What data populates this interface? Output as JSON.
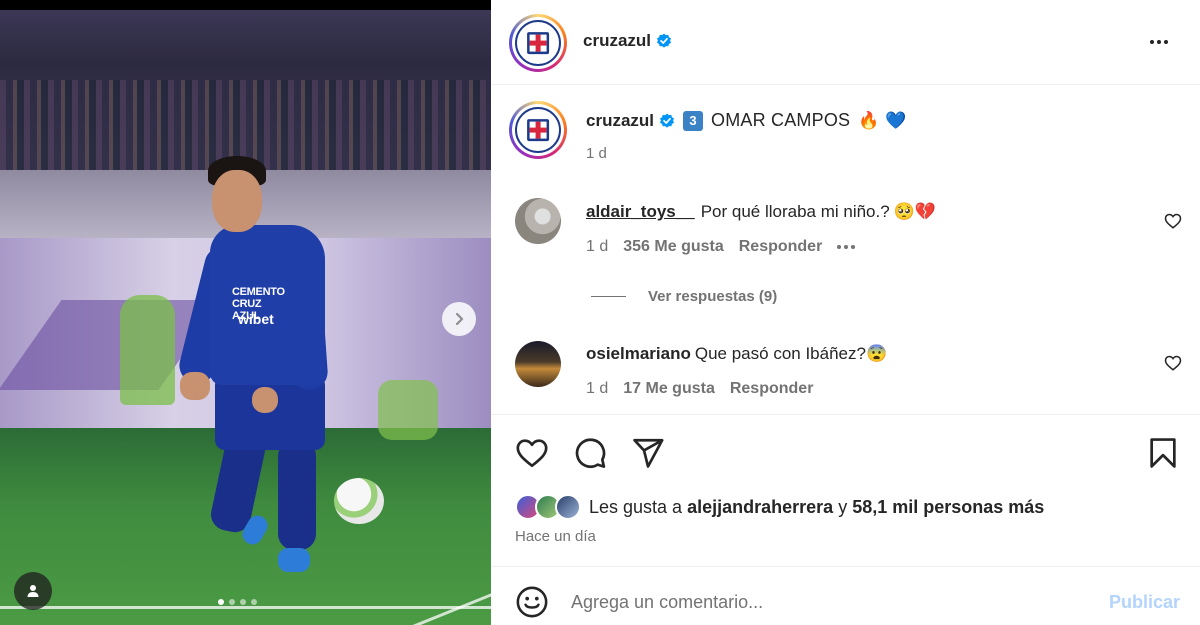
{
  "post": {
    "carousel": {
      "slides": 4,
      "active_index": 0
    },
    "author": {
      "username": "cruzazul",
      "verified": true
    },
    "caption": {
      "number_emoji": "3",
      "text": "OMAR CAMPOS",
      "emoji_1": "🔥",
      "emoji_2": "💙",
      "time": "1 d"
    },
    "jersey_sponsor_text": "CEMENTO CRUZ AZUL",
    "jersey_sponsor_text2": "wibet"
  },
  "comments": [
    {
      "username": "aldair_toys__",
      "text": "Por qué lloraba mi niño.?",
      "emoji": "🥺💔",
      "time": "1 d",
      "likes": "356 Me gusta",
      "reply_label": "Responder",
      "view_replies": "Ver respuestas (9)"
    },
    {
      "username": "osielmariano",
      "text": "Que pasó con Ibáñez?",
      "emoji": "😨",
      "time": "1 d",
      "likes": "17 Me gusta",
      "reply_label": "Responder"
    }
  ],
  "likes": {
    "prefix": "Les gusta a",
    "first_user": "alejjandraherrera",
    "connector": "y",
    "others": "58,1 mil personas más"
  },
  "post_time": "Hace un día",
  "composer": {
    "placeholder": "Agrega un comentario...",
    "publish_label": "Publicar"
  },
  "colors": {
    "accent": "#0095f6",
    "publish_disabled": "#b3d4fc",
    "verified": "#0095f6",
    "club_blue": "#1e3a8a"
  },
  "icons": [
    "verified-icon",
    "more-icon",
    "heart-icon",
    "comment-icon",
    "share-icon",
    "save-icon",
    "emoji-icon",
    "chevron-right-icon",
    "user-tag-icon"
  ]
}
